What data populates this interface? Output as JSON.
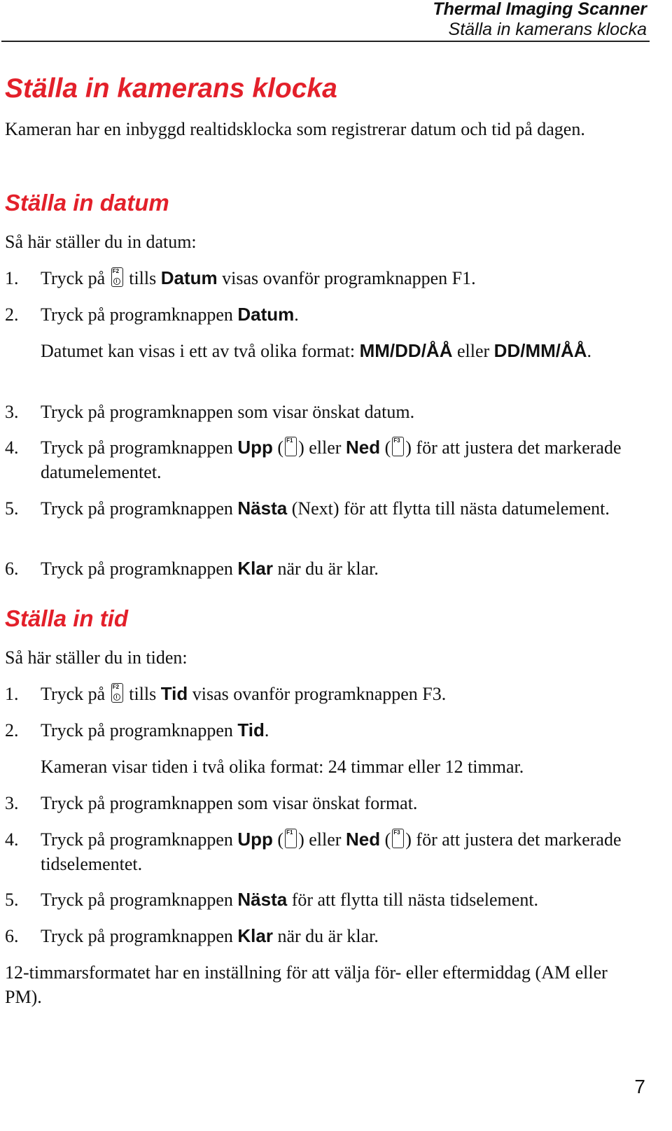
{
  "header": {
    "product": "Thermal Imaging Scanner",
    "section": "Ställa in kamerans klocka"
  },
  "title": "Ställa in kamerans klocka",
  "intro": "Kameran har en inbyggd realtidsklocka som registrerar datum och tid på dagen.",
  "date_section": {
    "heading": "Ställa in datum",
    "lead": "Så här ställer du in datum:",
    "steps": [
      {
        "num": "1.",
        "a": "Tryck på",
        "key": "F2",
        "b": "tills",
        "bold": "Datum",
        "c": "visas ovanför programknappen F1."
      },
      {
        "num": "2.",
        "a": "Tryck på programknappen",
        "bold": "Datum",
        "c": "."
      },
      {
        "num": "3.",
        "a": "Tryck på programknappen som visar önskat datum."
      },
      {
        "num": "4.",
        "a": "Tryck på programknappen",
        "bold1": "Upp",
        "key1": "F1",
        "mid": "eller",
        "bold2": "Ned",
        "key2": "F3",
        "c": "för att justera det markerade datumelementet."
      },
      {
        "num": "5.",
        "a": "Tryck på programknappen",
        "bold": "Nästa",
        "c": "(Next) för att flytta till nästa datumelement."
      },
      {
        "num": "6.",
        "a": "Tryck på programknappen",
        "bold": "Klar",
        "c": "när du är klar."
      }
    ],
    "note": {
      "a": "Datumet kan visas i ett av två olika format:",
      "fmt1": "MM/DD/ÅÅ",
      "mid": "eller",
      "fmt2": "DD/MM/ÅÅ",
      "end": "."
    }
  },
  "time_section": {
    "heading": "Ställa in tid",
    "lead": "Så här ställer du in tiden:",
    "steps": [
      {
        "num": "1.",
        "a": "Tryck på",
        "key": "F2",
        "b": "tills",
        "bold": "Tid",
        "c": "visas ovanför programknappen F3."
      },
      {
        "num": "2.",
        "a": "Tryck på programknappen",
        "bold": "Tid",
        "c": "."
      },
      {
        "num": "3.",
        "a": "Tryck på programknappen som visar önskat format."
      },
      {
        "num": "4.",
        "a": "Tryck på programknappen",
        "bold1": "Upp",
        "key1": "F1",
        "mid": "eller",
        "bold2": "Ned",
        "key2": "F3",
        "c": "för att justera det markerade tidselementet."
      },
      {
        "num": "5.",
        "a": "Tryck på programknappen",
        "bold": "Nästa",
        "c": "för att flytta till nästa tidselement."
      },
      {
        "num": "6.",
        "a": "Tryck på programknappen",
        "bold": "Klar",
        "c": "när du är klar."
      }
    ],
    "note": "Kameran visar tiden i två olika format: 24 timmar eller 12 timmar.",
    "footer_note": "12-timmarsformatet har en inställning för att välja för- eller eftermiddag (AM eller PM)."
  },
  "page_number": "7"
}
